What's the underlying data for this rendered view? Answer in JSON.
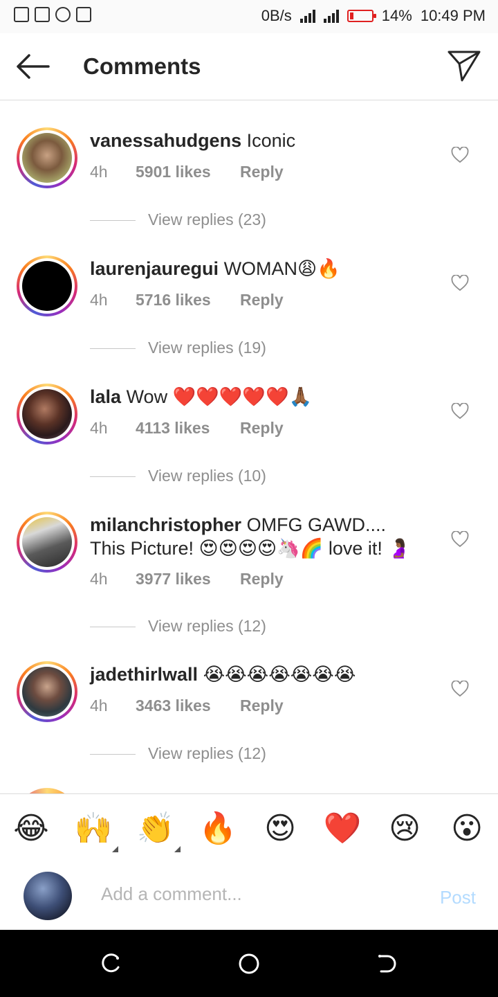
{
  "status_bar": {
    "net_speed": "0B/s",
    "battery": "14%",
    "time": "10:49 PM"
  },
  "header": {
    "title": "Comments"
  },
  "comments": [
    {
      "username": "vanessahudgens",
      "text": "Iconic",
      "time": "4h",
      "likes": "5901 likes",
      "reply_label": "Reply",
      "view_replies": "View replies (23)"
    },
    {
      "username": "laurenjauregui",
      "text": "WOMAN😩🔥",
      "time": "4h",
      "likes": "5716 likes",
      "reply_label": "Reply",
      "view_replies": "View replies (19)"
    },
    {
      "username": "lala",
      "text": "Wow ❤️❤️❤️❤️❤️🙏🏾",
      "time": "4h",
      "likes": "4113 likes",
      "reply_label": "Reply",
      "view_replies": "View replies (10)"
    },
    {
      "username": "milanchristopher",
      "text": "OMFG GAWD.... This Picture! 😍😍😍😍🦄🌈 love it! 🤰🏾",
      "time": "4h",
      "likes": "3977 likes",
      "reply_label": "Reply",
      "view_replies": "View replies (12)"
    },
    {
      "username": "jadethirlwall",
      "text": "😭😭😭😭😭😭😭",
      "time": "4h",
      "likes": "3463 likes",
      "reply_label": "Reply",
      "view_replies": "View replies (12)"
    }
  ],
  "emoji_bar": [
    "😂",
    "🙌",
    "👏",
    "🔥",
    "😍",
    "❤️",
    "😢",
    "😮"
  ],
  "composer": {
    "placeholder": "Add a comment...",
    "post_label": "Post"
  }
}
